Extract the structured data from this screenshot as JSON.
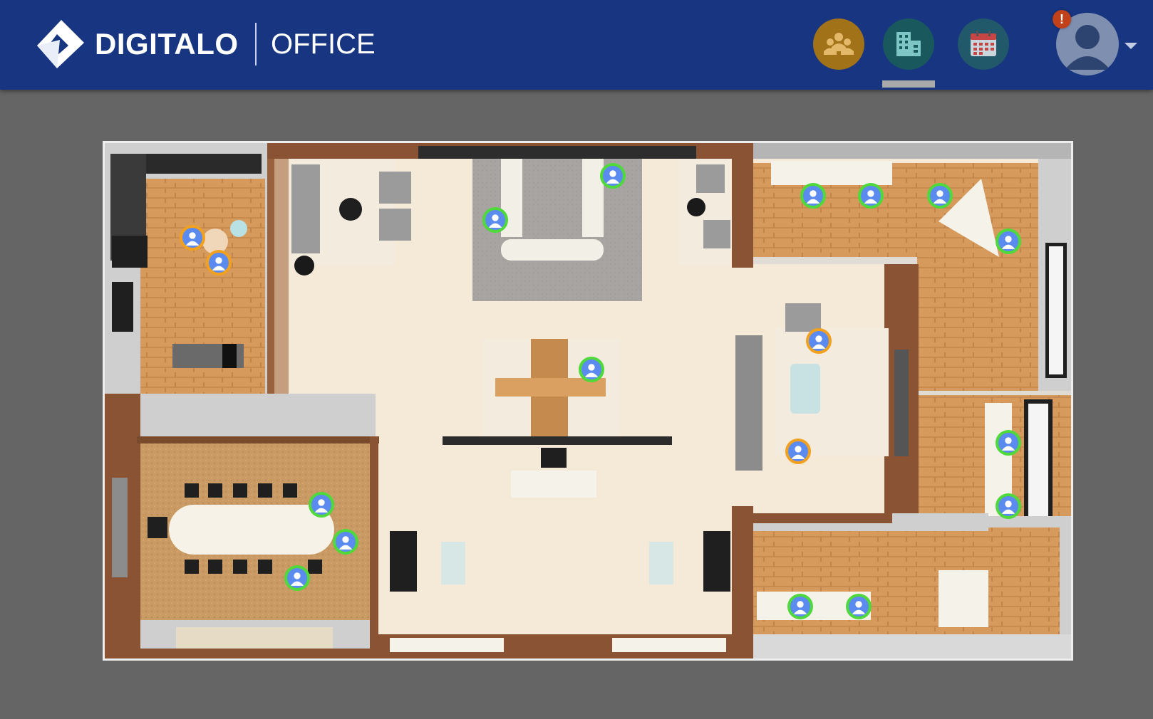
{
  "header": {
    "brand": "DIGITALO",
    "product": "OFFICE",
    "nav": [
      {
        "icon": "team-icon",
        "color": "#a27218"
      },
      {
        "icon": "building-icon",
        "color": "#19595e",
        "active": true
      },
      {
        "icon": "calendar-icon",
        "color": "#21586a"
      }
    ],
    "notification_badge": "!",
    "profile_icon": "user-avatar-icon"
  },
  "floorplan": {
    "status_colors": {
      "available": "#4fd93a",
      "away": "#f2a11f"
    },
    "occupants": [
      {
        "status": "away",
        "room": "kitchen"
      },
      {
        "status": "away",
        "room": "kitchen"
      },
      {
        "status": "available",
        "room": "open-area"
      },
      {
        "status": "available",
        "room": "open-area"
      },
      {
        "status": "available",
        "room": "north-east-office"
      },
      {
        "status": "available",
        "room": "north-east-office"
      },
      {
        "status": "available",
        "room": "north-east-office"
      },
      {
        "status": "available",
        "room": "north-east-office"
      },
      {
        "status": "available",
        "room": "central-desks"
      },
      {
        "status": "away",
        "room": "lounge"
      },
      {
        "status": "away",
        "room": "lounge"
      },
      {
        "status": "available",
        "room": "conference-room"
      },
      {
        "status": "available",
        "room": "conference-room"
      },
      {
        "status": "available",
        "room": "conference-room"
      },
      {
        "status": "available",
        "room": "east-office"
      },
      {
        "status": "available",
        "room": "east-office"
      },
      {
        "status": "available",
        "room": "south-east-office"
      },
      {
        "status": "available",
        "room": "south-east-office"
      }
    ]
  }
}
